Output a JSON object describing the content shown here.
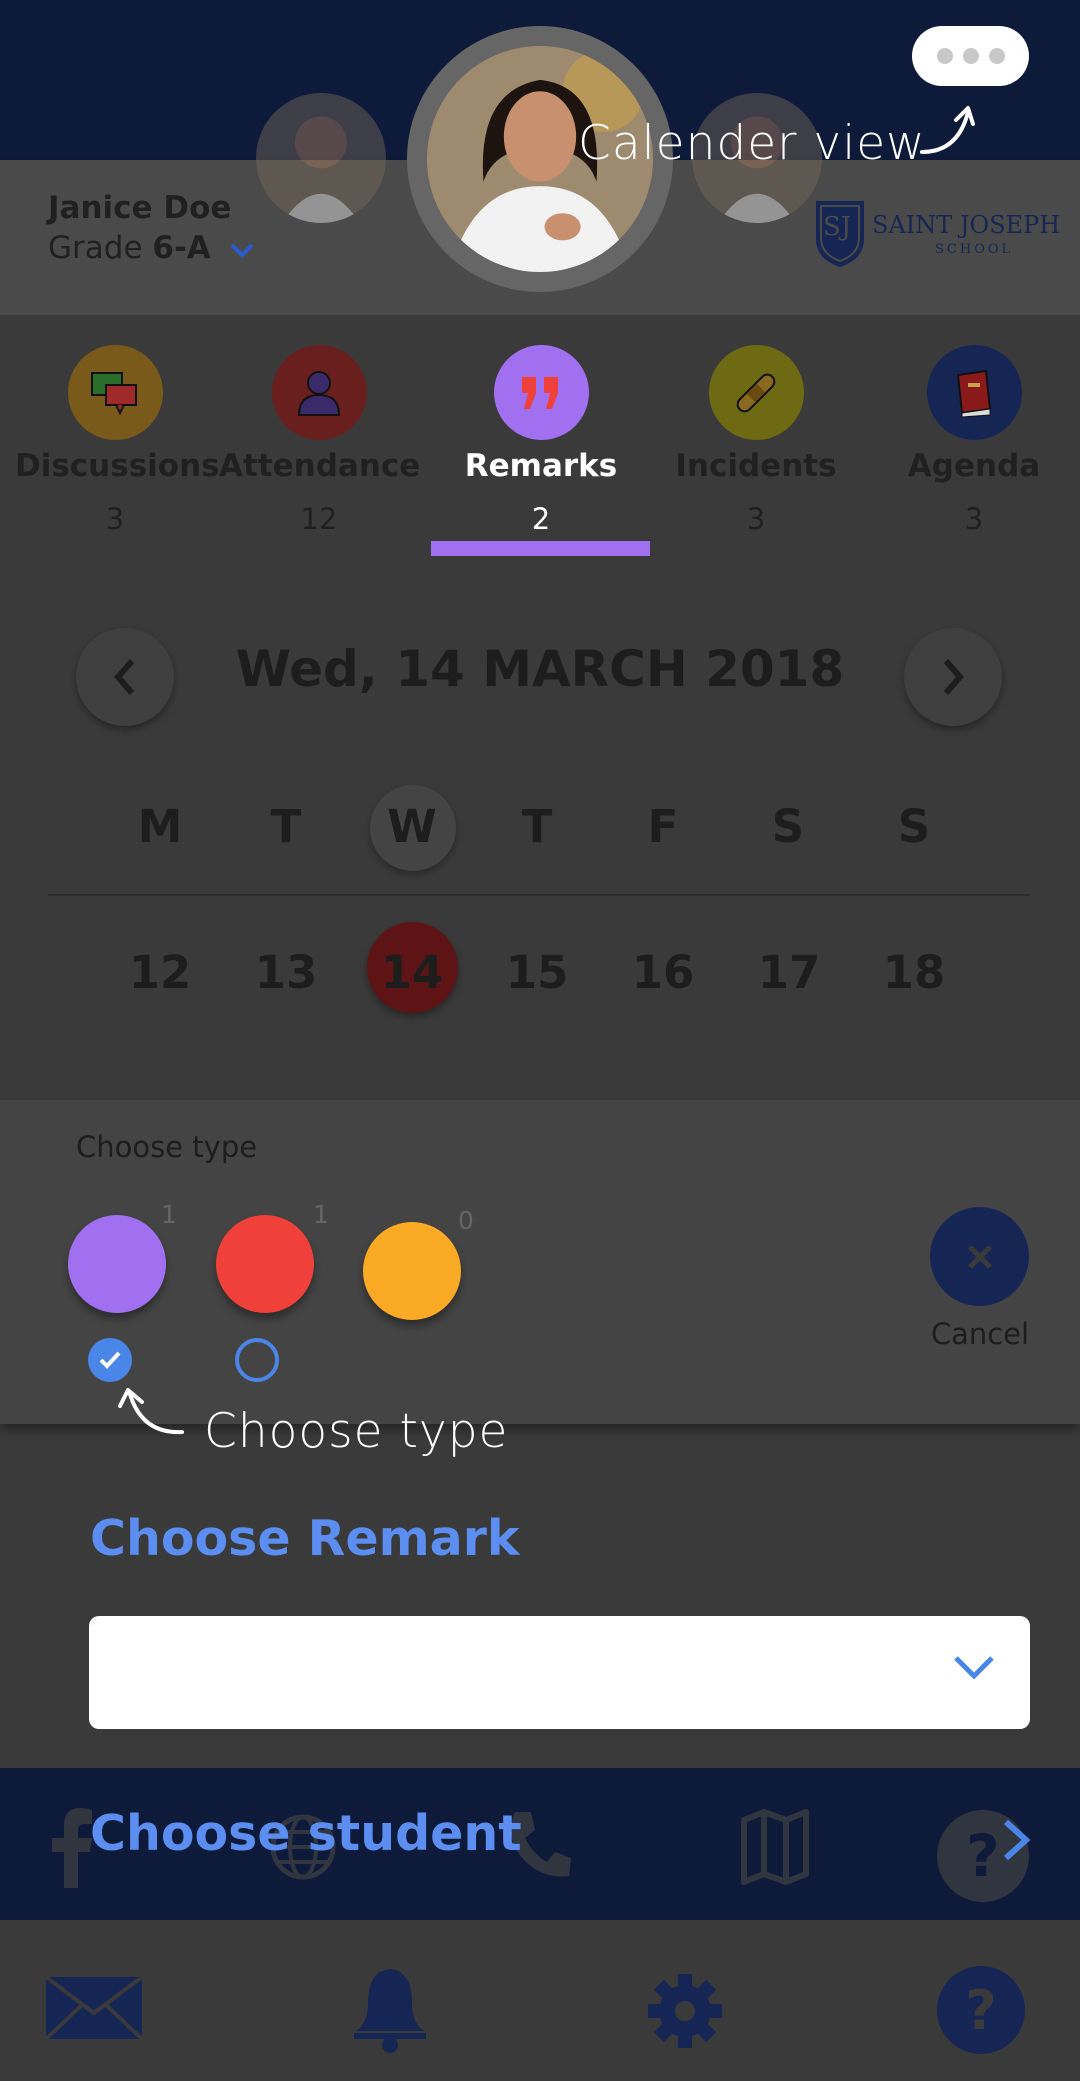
{
  "header": {
    "student_name": "Janice Doe",
    "grade_prefix": "Grade",
    "grade_value": "6-A",
    "school_name_line1": "SAINT JOSEPH",
    "school_name_line2": "SCHOOL",
    "school_monogram": "SJ"
  },
  "annotations": {
    "calender_view": "Calender view",
    "choose_type": "Choose type"
  },
  "tabs": [
    {
      "label": "Discussions",
      "count": "3",
      "icon": "chat-icon",
      "color": "#7a5a1a"
    },
    {
      "label": "Attendance",
      "count": "12",
      "icon": "person-icon",
      "color": "#6a1f1f"
    },
    {
      "label": "Remarks",
      "count": "2",
      "icon": "quote-icon",
      "color": "#a070f0",
      "active": true
    },
    {
      "label": "Incidents",
      "count": "3",
      "icon": "bandage-icon",
      "color": "#6e6a14"
    },
    {
      "label": "Agenda",
      "count": "3",
      "icon": "book-icon",
      "color": "#162654"
    }
  ],
  "calendar": {
    "date_title": "Wed, 14 MARCH 2018",
    "weekdays": [
      "M",
      "T",
      "W",
      "T",
      "F",
      "S",
      "S"
    ],
    "days": [
      "12",
      "13",
      "14",
      "15",
      "16",
      "17",
      "18"
    ],
    "selected_day": "14"
  },
  "type_panel": {
    "title": "Choose type",
    "types": [
      {
        "color": "#a070f0",
        "count": "1",
        "selected": true
      },
      {
        "color": "#f0403a",
        "count": "1",
        "selected": false
      },
      {
        "color": "#fbaa25",
        "count": "0",
        "selected": false
      }
    ],
    "cancel_label": "Cancel"
  },
  "remark": {
    "heading": "Choose Remark",
    "select_value": ""
  },
  "student": {
    "heading": "Choose student"
  },
  "colors": {
    "accent_blue": "#5b8ef0",
    "navy": "#0e1a3a",
    "purple": "#a070f0"
  }
}
